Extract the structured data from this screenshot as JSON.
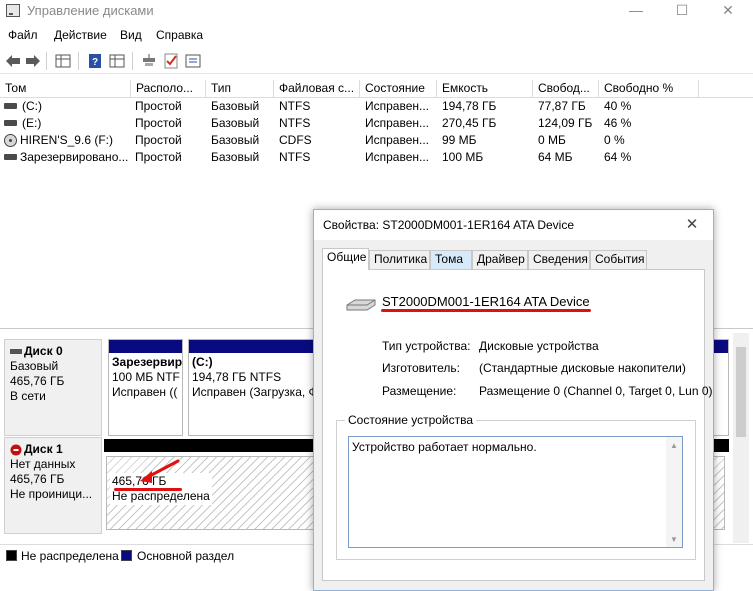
{
  "window": {
    "title": "Управление дисками",
    "minimize": "—",
    "maximize": "☐",
    "close": "✕"
  },
  "menu": [
    "Файл",
    "Действие",
    "Вид",
    "Справка"
  ],
  "toolbar_icons": [
    "back-arrow-icon",
    "forward-arrow-icon",
    "grid-view-icon",
    "help-icon",
    "grid-view-icon",
    "connect-icon",
    "check-icon",
    "properties-icon"
  ],
  "volume_table": {
    "columns": [
      "Том",
      "Располо...",
      "Тип",
      "Файловая с...",
      "Состояние",
      "Емкость",
      "Свобод...",
      "Свободно %"
    ],
    "rows": [
      [
        "(C:)",
        "Простой",
        "Базовый",
        "NTFS",
        "Исправен...",
        "194,78 ГБ",
        "77,87 ГБ",
        "40 %"
      ],
      [
        "(E:)",
        "Простой",
        "Базовый",
        "NTFS",
        "Исправен...",
        "270,45 ГБ",
        "124,09 ГБ",
        "46 %"
      ],
      [
        "HIREN'S_9.6 (F:)",
        "Простой",
        "Базовый",
        "CDFS",
        "Исправен...",
        "99 МБ",
        "0 МБ",
        "0 %"
      ],
      [
        "Зарезервировано...",
        "Простой",
        "Базовый",
        "NTFS",
        "Исправен...",
        "100 МБ",
        "64 МБ",
        "64 %"
      ]
    ]
  },
  "disks": {
    "disk0": {
      "name": "Диск 0",
      "type": "Базовый",
      "size": "465,76 ГБ",
      "status": "В сети",
      "partitions": [
        {
          "name": "Зарезервир",
          "size": "100 МБ NTF",
          "status": "Исправен (("
        },
        {
          "name": "(C:)",
          "size": "194,78 ГБ NTFS",
          "status": "Исправен (Загрузка, Ф"
        }
      ]
    },
    "disk1": {
      "name": "Диск 1",
      "line1": "Нет данных",
      "size": "465,76 ГБ",
      "status": "Не проиници...",
      "unallocated_size": "465,76 ГБ",
      "unallocated_label": "Не распределена"
    }
  },
  "legend": [
    {
      "label": "Не распределена",
      "color": "#000000"
    },
    {
      "label": "Основной раздел",
      "color": "#0a0a80"
    }
  ],
  "dialog": {
    "title": "Свойства: ST2000DM001-1ER164 ATA Device",
    "close": "✕",
    "tabs": [
      "Общие",
      "Политика",
      "Тома",
      "Драйвер",
      "Сведения",
      "События"
    ],
    "device_name": "ST2000DM001-1ER164 ATA Device",
    "properties": [
      {
        "label": "Тип устройства:",
        "value": "Дисковые устройства"
      },
      {
        "label": "Изготовитель:",
        "value": "(Стандартные дисковые накопители)"
      },
      {
        "label": "Размещение:",
        "value": "Размещение 0 (Channel 0, Target 0, Lun 0)"
      }
    ],
    "status_group_title": "Состояние устройства",
    "status_text": "Устройство работает нормально."
  },
  "colors": {
    "primary_partition": "#0a0a80",
    "unallocated": "#000000",
    "annotation": "#e01010"
  }
}
